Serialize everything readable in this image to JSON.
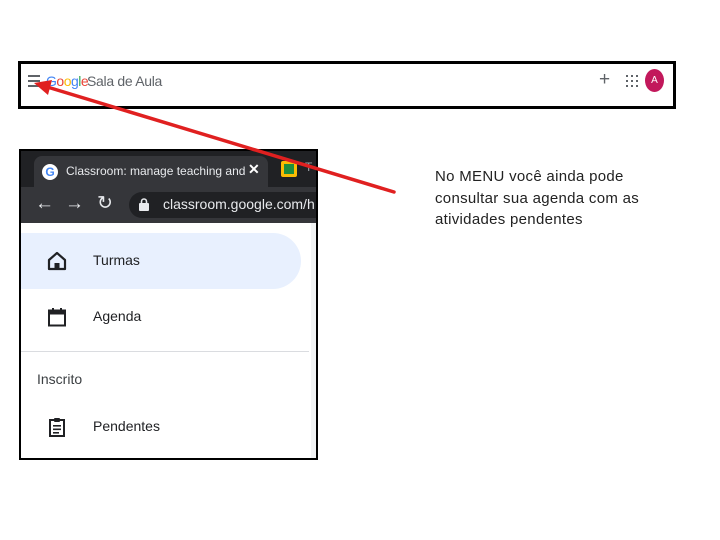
{
  "classroom_bar": {
    "logo_letters": [
      "G",
      "o",
      "o",
      "g",
      "l",
      "e"
    ],
    "app_name": "Sala de Aula",
    "plus_icon": "plus-icon",
    "avatar_letter": "A",
    "avatar_color": "#c2185b"
  },
  "browser": {
    "tab_title": "Classroom: manage teaching and",
    "tab_close": "✕",
    "tab_more": "T",
    "url": "classroom.google.com/h"
  },
  "menu": {
    "items": [
      {
        "label": "Turmas",
        "icon": "home-icon",
        "active": true
      },
      {
        "label": "Agenda",
        "icon": "calendar-icon",
        "active": false
      }
    ],
    "section_label": "Inscrito",
    "section_items": [
      {
        "label": "Pendentes",
        "icon": "assignment-icon"
      }
    ]
  },
  "annotation": {
    "text": "No MENU você ainda pode consultar sua agenda com as atividades pendentes",
    "arrow_color": "#e02020"
  }
}
